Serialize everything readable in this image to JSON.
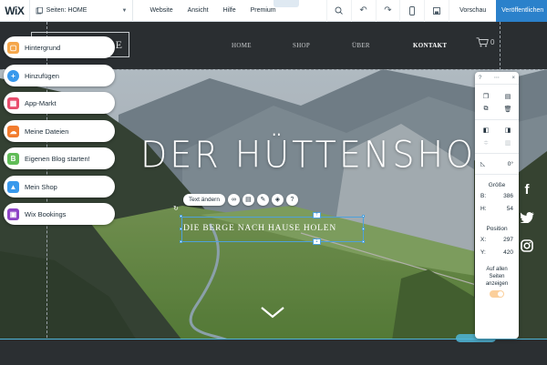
{
  "topbar": {
    "logo": "WiX",
    "pages_label": "Seiten: HOME",
    "menu": [
      "Website",
      "Ansicht",
      "Hilfe",
      "Premium"
    ],
    "preview": "Vorschau",
    "publish": "Veröffentlichen"
  },
  "site": {
    "logo_text": "TORTHOLE",
    "nav": [
      "HOME",
      "SHOP",
      "ÜBER",
      "KONTAKT"
    ],
    "cart_count": "0",
    "hero_title": "DER HÜTTENSHOP",
    "hero_subtitle": "DIE BERGE NACH HAUSE HOLEN",
    "text_edit_label": "Text ändern"
  },
  "left_panel": [
    {
      "label": "Hintergrund",
      "icon": "background-icon",
      "color": "#f5a64a"
    },
    {
      "label": "Hinzufügen",
      "icon": "add-icon",
      "color": "#3899ec"
    },
    {
      "label": "App-Markt",
      "icon": "app-market-icon",
      "color": "#e84d6c"
    },
    {
      "label": "Meine Dateien",
      "icon": "my-files-icon",
      "color": "#f27c2e"
    },
    {
      "label": "Eigenen Blog starten!",
      "icon": "blog-icon",
      "color": "#60bc57"
    },
    {
      "label": "Mein Shop",
      "icon": "shop-icon",
      "color": "#3899ec"
    },
    {
      "label": "Wix Bookings",
      "icon": "bookings-icon",
      "color": "#8e44c6"
    }
  ],
  "inspector": {
    "help": "?",
    "close": "×",
    "rotation": "0°",
    "size_label": "Größe",
    "width_label": "B:",
    "width_value": "386",
    "height_label": "H:",
    "height_value": "54",
    "position_label": "Position",
    "x_label": "X:",
    "x_value": "297",
    "y_label": "Y:",
    "y_value": "420",
    "all_pages_label": "Auf allen Seiten anzeigen"
  },
  "social": [
    "facebook-icon",
    "twitter-icon",
    "instagram-icon"
  ],
  "colors": {
    "publish": "#2b81cb",
    "selection": "#4ea1dc",
    "footer_line": "#4fb6d8"
  }
}
